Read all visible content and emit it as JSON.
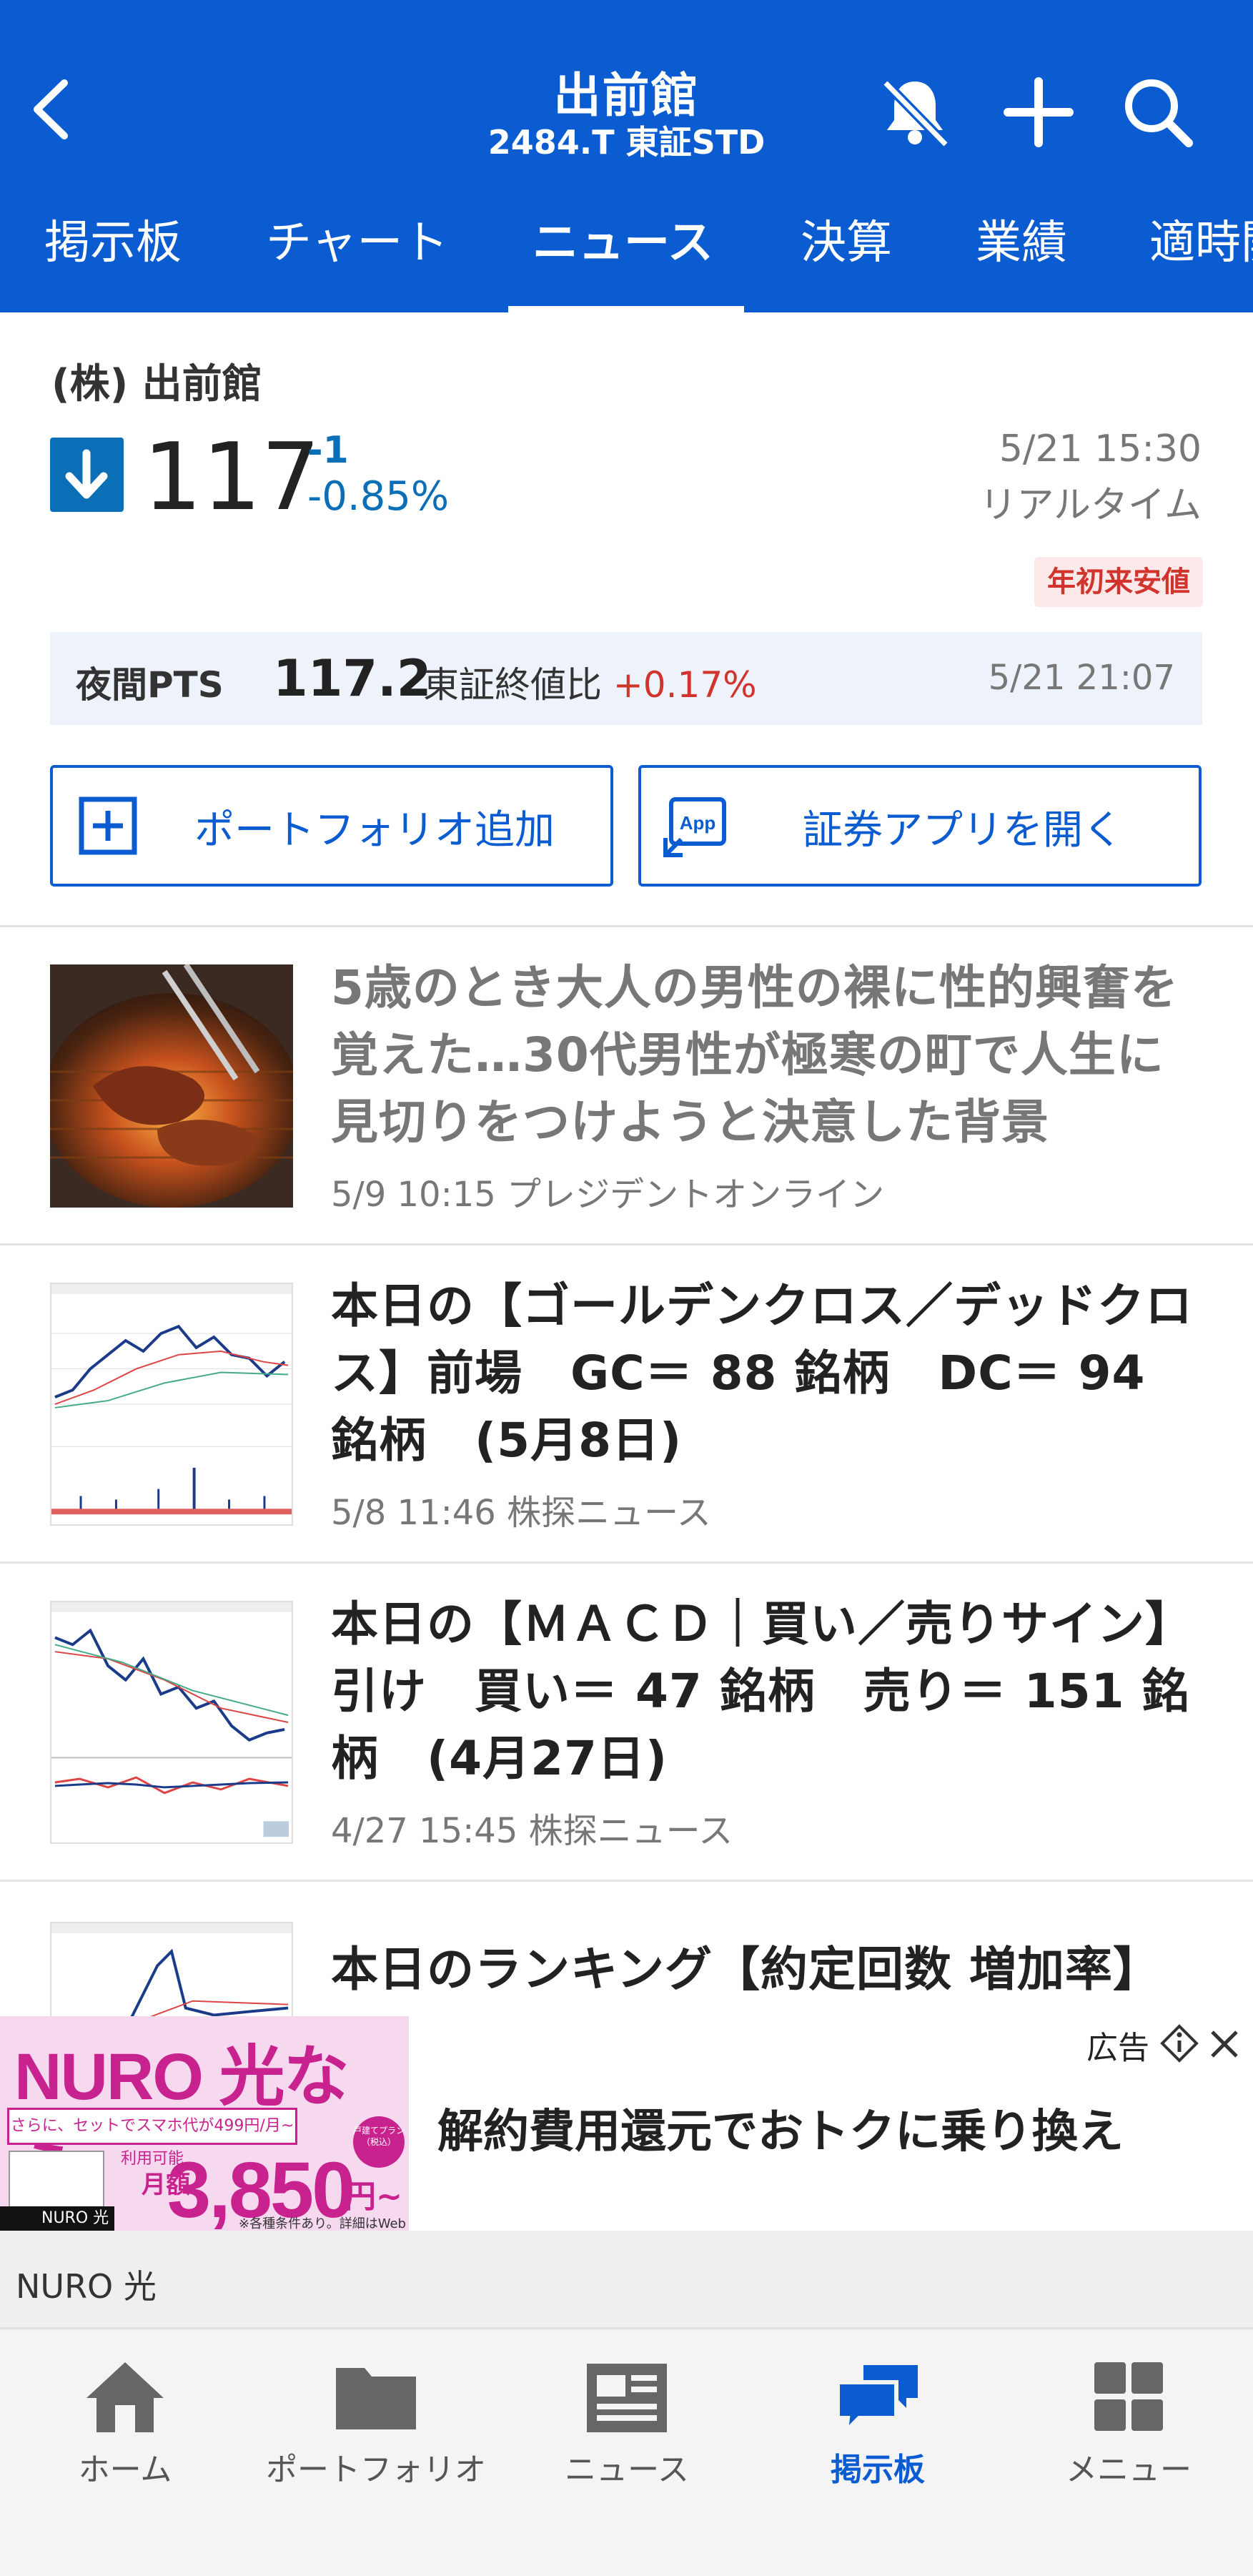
{
  "header": {
    "title": "出前館",
    "subtitle": "2484.T 東証STD"
  },
  "tabs": [
    {
      "label": "掲示板"
    },
    {
      "label": "チャート"
    },
    {
      "label": "ニュース"
    },
    {
      "label": "決算"
    },
    {
      "label": "業績"
    },
    {
      "label": "適時開示"
    }
  ],
  "stock": {
    "name": "(株) 出前館",
    "price": "117",
    "change": "-1",
    "change_pct": "-0.85%",
    "time": "5/21 15:30",
    "realtime": "リアルタイム",
    "badge": "年初来安値"
  },
  "pts": {
    "label": "夜間PTS",
    "price": "117.2",
    "compare_label": "東証終値比",
    "compare_value": "+0.17%",
    "time": "5/21 21:07"
  },
  "actions": {
    "portfolio": "ポートフォリオ追加",
    "open_app": "証券アプリを開く",
    "app_icon_text": "App"
  },
  "news": [
    {
      "title": "5歳のとき大人の男性の裸に性的興奮を覚えた…30代男性が極寒の町で人生に見切りをつけようと決意した背景",
      "meta": "5/9 10:15 プレジデントオンライン"
    },
    {
      "title": "本日の【ゴールデンクロス／デッドクロス】前場　GC＝ 88 銘柄　DC＝ 94 銘柄　(5月8日)",
      "meta": "5/8 11:46 株探ニュース"
    },
    {
      "title": "本日の【ＭＡＣＤ｜買い／売りサイン】引け　買い＝ 47 銘柄　売り＝ 151 銘柄　(4月27日)",
      "meta": "4/27 15:45 株探ニュース"
    },
    {
      "title": "本日のランキング【約定回数 増加率】"
    }
  ],
  "ad": {
    "brand_big": "NURO 光なら",
    "promo": "さらに、セットでスマホ代が499円/月~利用可能",
    "price": "3,850",
    "price_unit": "円~",
    "price_prefix": "月額",
    "plan_note": "戸建てプラン（税込）",
    "fine_print": "※各種条件あり。詳細はWebで。",
    "logo": "NURO 光",
    "headline": "解約費用還元でおトクに乗り換え",
    "label": "広告",
    "sponsor": "NURO 光"
  },
  "bottom_nav": [
    {
      "label": "ホーム"
    },
    {
      "label": "ポートフォリオ"
    },
    {
      "label": "ニュース"
    },
    {
      "label": "掲示板"
    },
    {
      "label": "メニュー"
    }
  ],
  "colors": {
    "brand": "#0b5cd1",
    "down": "#0b6fb8",
    "up": "#d0342c",
    "badge_bg": "#fde8ea"
  }
}
